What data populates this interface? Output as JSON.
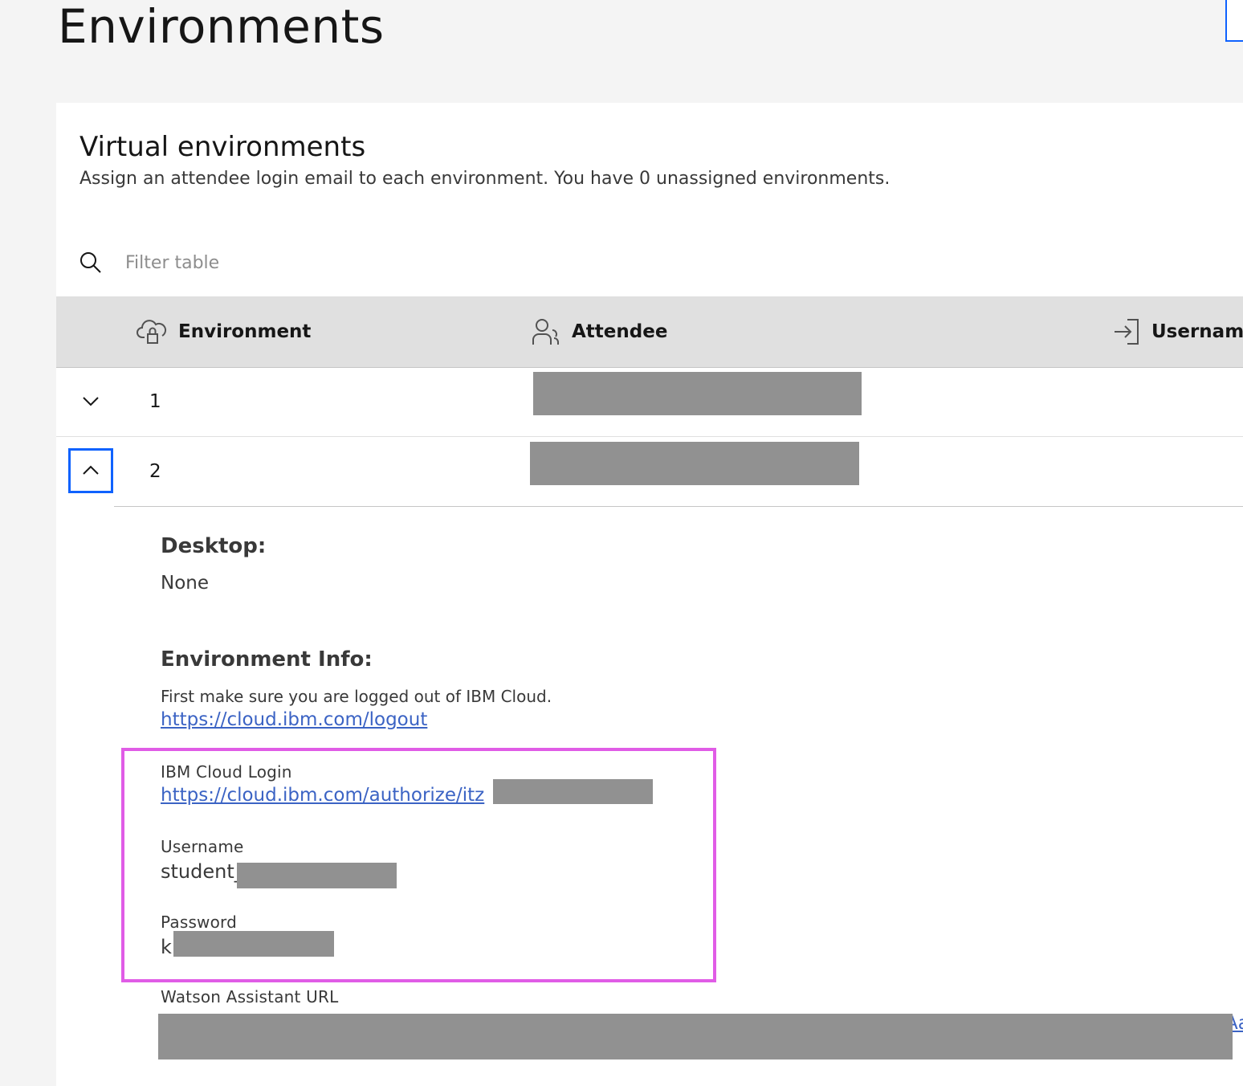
{
  "page": {
    "title": "Environments"
  },
  "card": {
    "title": "Virtual environments",
    "description": "Assign an attendee login email to each environment. You have 0 unassigned environments."
  },
  "search": {
    "placeholder": "Filter table",
    "value": ""
  },
  "table": {
    "columns": [
      {
        "label": "Environment",
        "icon": "cloud-lock-icon"
      },
      {
        "label": "Attendee",
        "icon": "user-icon"
      },
      {
        "label": "Username",
        "icon": "login-icon"
      }
    ],
    "rows": [
      {
        "number": "1",
        "expanded": false
      },
      {
        "number": "2",
        "expanded": true
      }
    ]
  },
  "details": {
    "desktop_heading": "Desktop:",
    "desktop_value": "None",
    "env_info_heading": "Environment Info:",
    "logout_instruction": "First make sure you are logged out of IBM Cloud.",
    "logout_link": "https://cloud.ibm.com/logout",
    "login_label": "IBM Cloud Login",
    "login_link": "https://cloud.ibm.com/authorize/itz",
    "username_label": "Username",
    "username_value": "student_",
    "password_label": "Password",
    "password_value": "k",
    "watson_label": "Watson Assistant URL",
    "watson_link_tail": "Aa"
  },
  "colors": {
    "page_bg": "#f4f4f4",
    "card_bg": "#ffffff",
    "header_bg": "#e0e0e0",
    "link": "#3b63c4",
    "focus": "#0f62fe",
    "highlight": "#e05ce6",
    "redaction": "#919191"
  }
}
